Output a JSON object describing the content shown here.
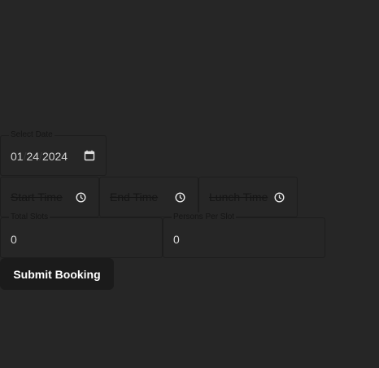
{
  "form": {
    "date": {
      "label": "Select Date",
      "month": "01",
      "day": "24",
      "year": "2024",
      "separator": "/",
      "icon": "calendar-icon"
    },
    "start_time": {
      "placeholder": "Start Time",
      "icon": "clock-icon"
    },
    "end_time": {
      "placeholder": "End Time",
      "icon": "clock-icon"
    },
    "lunch_time": {
      "placeholder": "Lunch Time",
      "icon": "clock-icon"
    },
    "total_slots": {
      "label": "Total Slots",
      "value": "0"
    },
    "persons_per_slot": {
      "label": "Persons Per Slot",
      "value": "0"
    },
    "submit_label": "Submit Booking"
  },
  "colors": {
    "background": "#262626",
    "field_border": "#1d1d1d",
    "button_background": "#1b1b1b",
    "button_text": "#ffffff"
  }
}
